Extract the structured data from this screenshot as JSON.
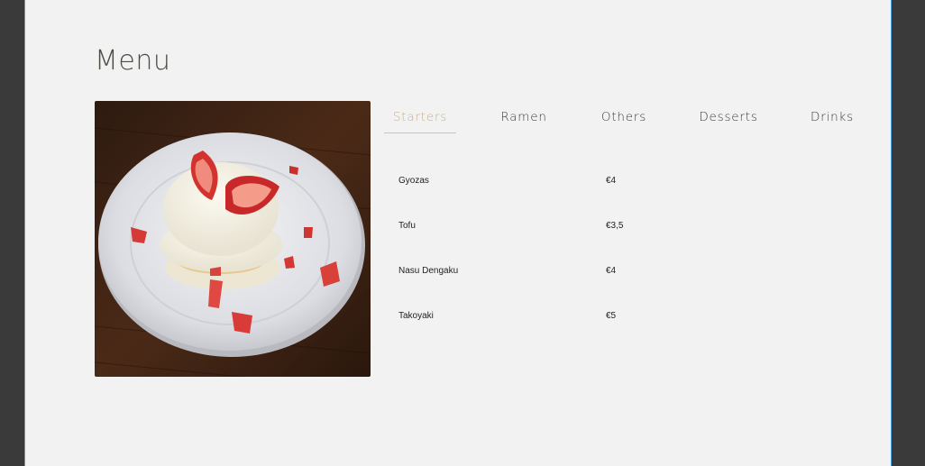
{
  "page": {
    "title": "Menu"
  },
  "image": {
    "subject": "strawberry-pancake-photo"
  },
  "tabs": [
    {
      "label": "Starters",
      "active": true
    },
    {
      "label": "Ramen",
      "active": false
    },
    {
      "label": "Others",
      "active": false
    },
    {
      "label": "Desserts",
      "active": false
    },
    {
      "label": "Drinks",
      "active": false
    }
  ],
  "items": [
    {
      "name": "Gyozas",
      "price": "€4"
    },
    {
      "name": "Tofu",
      "price": "€3,5"
    },
    {
      "name": "Nasu Dengaku",
      "price": "€4"
    },
    {
      "name": "Takoyaki",
      "price": "€5"
    }
  ],
  "colors": {
    "accent": "#c9b089",
    "background": "#f2f2f2",
    "frame": "#3a3a3a"
  }
}
